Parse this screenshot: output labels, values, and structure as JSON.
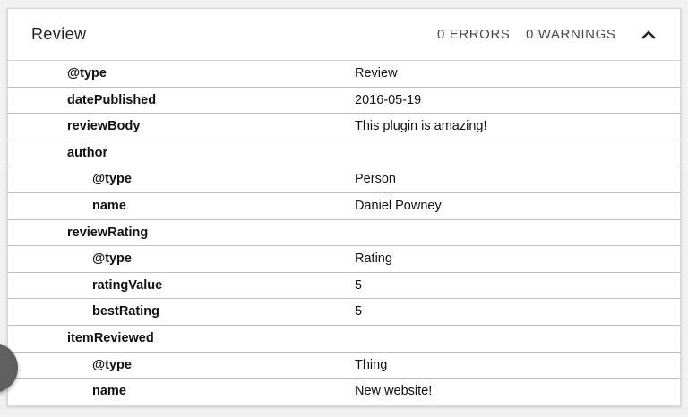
{
  "header": {
    "title": "Review",
    "errors": "0 ERRORS",
    "warnings": "0 WARNINGS",
    "collapse_icon": "chevron-up-icon"
  },
  "rows": [
    {
      "key": "@type",
      "value": "Review",
      "level": 0
    },
    {
      "key": "datePublished",
      "value": "2016-05-19",
      "level": 0
    },
    {
      "key": "reviewBody",
      "value": "This plugin is amazing!",
      "level": 0
    },
    {
      "key": "author",
      "value": "",
      "level": 0
    },
    {
      "key": "@type",
      "value": "Person",
      "level": 1
    },
    {
      "key": "name",
      "value": "Daniel Powney",
      "level": 1
    },
    {
      "key": "reviewRating",
      "value": "",
      "level": 0
    },
    {
      "key": "@type",
      "value": "Rating",
      "level": 1
    },
    {
      "key": "ratingValue",
      "value": "5",
      "level": 1
    },
    {
      "key": "bestRating",
      "value": "5",
      "level": 1
    },
    {
      "key": "itemReviewed",
      "value": "",
      "level": 0
    },
    {
      "key": "@type",
      "value": "Thing",
      "level": 1
    },
    {
      "key": "name",
      "value": "New website!",
      "level": 1
    }
  ],
  "colors": {
    "panel_bg": "#ffffff",
    "border": "#bdbdbd",
    "text": "#111111",
    "muted_text": "#4a4a4a",
    "fab": "#5f5f5f"
  }
}
